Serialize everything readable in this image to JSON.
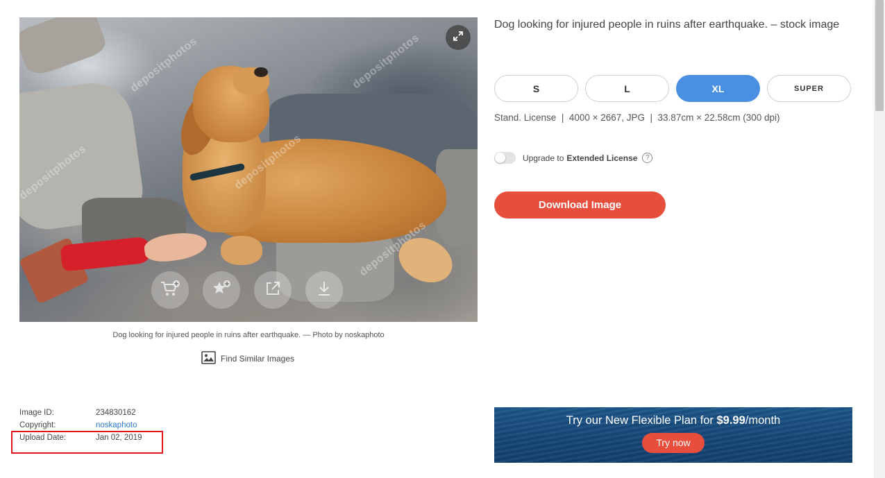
{
  "photo": {
    "watermark_text": "depositphotos",
    "actions": [
      {
        "icon": "add-to-cart-icon"
      },
      {
        "icon": "add-to-favorites-icon"
      },
      {
        "icon": "share-icon"
      },
      {
        "icon": "download-icon"
      }
    ],
    "expand_icon": "expand-icon"
  },
  "caption": "Dog looking for injured people in ruins after earthquake. — Photo by noskaphoto",
  "find_similar_label": "Find Similar Images",
  "meta": {
    "image_id_label": "Image ID:",
    "image_id_value": "234830162",
    "copyright_label": "Copyright:",
    "copyright_value": "noskaphoto",
    "upload_date_label": "Upload Date:",
    "upload_date_value": "Jan 02, 2019"
  },
  "title": "Dog looking for injured people in ruins after earthquake.  –  stock image",
  "sizes": [
    {
      "label": "S",
      "active": false
    },
    {
      "label": "L",
      "active": false
    },
    {
      "label": "XL",
      "active": true
    },
    {
      "label": "SUPER",
      "active": false
    }
  ],
  "license_info": "Stand. License  |  4000 × 2667, JPG  |  33.87cm × 22.58cm (300 dpi)",
  "upgrade": {
    "prefix": "Upgrade to",
    "bold": "Extended License",
    "help": "?"
  },
  "download_label": "Download Image",
  "promo": {
    "text_prefix": "Try our New Flexible Plan for ",
    "price": "$9.99",
    "text_suffix": "/month",
    "button_label": "Try now"
  },
  "colors": {
    "accent_blue": "#4a90e2",
    "download_red": "#e84e3c",
    "link_blue": "#2b7bd1",
    "highlight_red": "#e0131e"
  }
}
